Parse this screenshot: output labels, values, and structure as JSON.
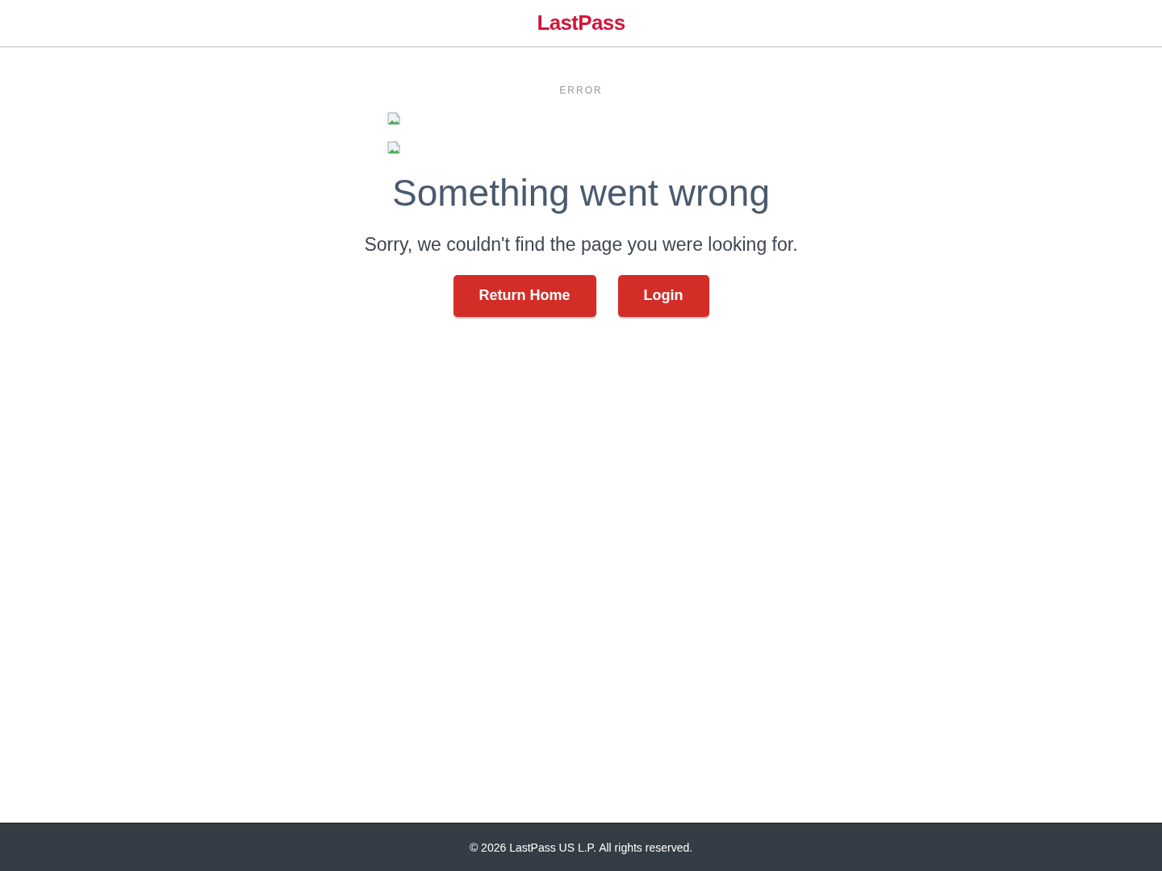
{
  "header": {
    "logo": "LastPass"
  },
  "eyebrow": "ERROR",
  "title": "Something went wrong",
  "message": "Sorry, we couldn't find the page you were looking for.",
  "buttons": [
    "Return Home",
    "Login"
  ],
  "footer": "© 2026 LastPass US L.P. All rights reserved."
}
